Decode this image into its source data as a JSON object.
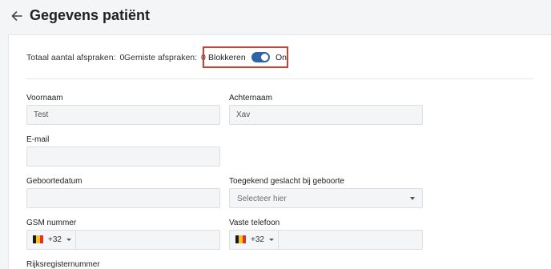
{
  "header": {
    "title": "Gegevens patiënt",
    "back_icon": "arrow-left-icon"
  },
  "stats": {
    "total_label": "Totaal aantal afspraken:",
    "total_value": "0",
    "missed_label": "Gemiste afspraken:",
    "missed_value": "0",
    "block_label": "Blokkeren",
    "block_state": "On",
    "block_on": true
  },
  "form": {
    "first_name": {
      "label": "Voornaam",
      "value": "Test"
    },
    "last_name": {
      "label": "Achternaam",
      "value": "Xav"
    },
    "email": {
      "label": "E-mail",
      "value": ""
    },
    "birthdate": {
      "label": "Geboortedatum",
      "value": ""
    },
    "gender": {
      "label": "Toegekend geslacht bij geboorte",
      "placeholder": "Selecteer hier"
    },
    "mobile": {
      "label": "GSM nummer",
      "country_code": "+32",
      "value": ""
    },
    "landline": {
      "label": "Vaste telefoon",
      "country_code": "+32",
      "value": ""
    },
    "national_id": {
      "label": "Rijksregisternummer"
    }
  },
  "colors": {
    "accent": "#2f64a8",
    "highlight_border": "#d93a2b",
    "flag_black": "#1a1a1a",
    "flag_yellow": "#f5c518",
    "flag_red": "#e0302e"
  }
}
